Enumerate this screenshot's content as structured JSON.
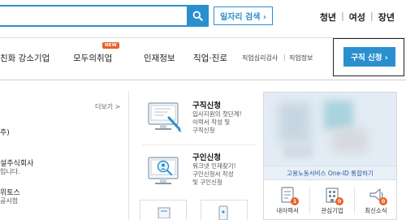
{
  "header": {
    "search_placeholder": "",
    "job_search_label": "일자리 검색 ›",
    "audience": [
      "청년",
      "여성",
      "장년"
    ]
  },
  "nav": {
    "items": [
      "친화 강소기업",
      "모두의취업",
      "인재정보",
      "직업·진로"
    ],
    "new_badge": "NEW",
    "sub_items": [
      "직업심리검사",
      "직업정보"
    ],
    "apply_label": "구직 신청 ›"
  },
  "left": {
    "more": "더보기 >",
    "lines": [
      "주)",
      "설주식회사",
      "입니다.",
      "위토스",
      "공시험"
    ]
  },
  "services": [
    {
      "title": "구직신청",
      "desc": [
        "입사지원의 첫단계!",
        "이력서 작성 및",
        "구직신청"
      ]
    },
    {
      "title": "구인신청",
      "desc": [
        "워크넷 인재찾기!",
        "구인신청서 작성",
        "및 구인신청"
      ]
    }
  ],
  "right_panel": {
    "oneid_label": "고용노동서비스 One-ID 통합하기",
    "quick": [
      {
        "label": "내이력서",
        "count": "1",
        "icon": "resume-icon"
      },
      {
        "label": "관심기업",
        "count": "0",
        "icon": "company-icon"
      },
      {
        "label": "최신소식",
        "count": "0",
        "icon": "notice-icon"
      }
    ]
  },
  "colors": {
    "accent": "#2a8fcf",
    "badge": "#e8622b"
  }
}
